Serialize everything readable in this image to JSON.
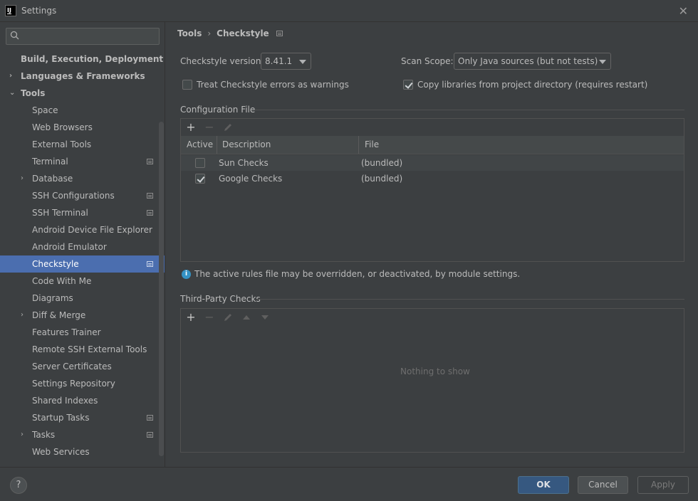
{
  "window": {
    "title": "Settings"
  },
  "sidebar": {
    "search_placeholder": "",
    "items": [
      {
        "label": "Build, Execution, Deployment",
        "level": 0,
        "bold": true,
        "arrow": ""
      },
      {
        "label": "Languages & Frameworks",
        "level": 0,
        "bold": true,
        "arrow": "›"
      },
      {
        "label": "Tools",
        "level": 0,
        "bold": true,
        "arrow": "⌄"
      },
      {
        "label": "Space",
        "level": 1
      },
      {
        "label": "Web Browsers",
        "level": 1
      },
      {
        "label": "External Tools",
        "level": 1
      },
      {
        "label": "Terminal",
        "level": 1,
        "project": true
      },
      {
        "label": "Database",
        "level": 1,
        "arrow": "›"
      },
      {
        "label": "SSH Configurations",
        "level": 1,
        "project": true
      },
      {
        "label": "SSH Terminal",
        "level": 1,
        "project": true
      },
      {
        "label": "Android Device File Explorer",
        "level": 1
      },
      {
        "label": "Android Emulator",
        "level": 1
      },
      {
        "label": "Checkstyle",
        "level": 1,
        "project": true,
        "selected": true
      },
      {
        "label": "Code With Me",
        "level": 1
      },
      {
        "label": "Diagrams",
        "level": 1
      },
      {
        "label": "Diff & Merge",
        "level": 1,
        "arrow": "›"
      },
      {
        "label": "Features Trainer",
        "level": 1
      },
      {
        "label": "Remote SSH External Tools",
        "level": 1
      },
      {
        "label": "Server Certificates",
        "level": 1
      },
      {
        "label": "Settings Repository",
        "level": 1
      },
      {
        "label": "Shared Indexes",
        "level": 1
      },
      {
        "label": "Startup Tasks",
        "level": 1,
        "project": true
      },
      {
        "label": "Tasks",
        "level": 1,
        "project": true,
        "arrow": "›"
      },
      {
        "label": "Web Services",
        "level": 1
      }
    ]
  },
  "breadcrumb": {
    "parent": "Tools",
    "separator": "›",
    "current": "Checkstyle"
  },
  "checkstyle": {
    "version_label": "Checkstyle version:",
    "version_value": "8.41.1",
    "scope_label": "Scan Scope:",
    "scope_value": "Only Java sources (but not tests)",
    "treat_errors_label": "Treat Checkstyle errors as warnings",
    "treat_errors_checked": false,
    "copy_libs_label": "Copy libraries from project directory (requires restart)",
    "copy_libs_checked": true
  },
  "config_file": {
    "title": "Configuration File",
    "columns": [
      "Active",
      "Description",
      "File"
    ],
    "rows": [
      {
        "active": false,
        "description": "Sun Checks",
        "file": "(bundled)"
      },
      {
        "active": true,
        "description": "Google Checks",
        "file": "(bundled)"
      }
    ],
    "info_text": "The active rules file may be overridden, or deactivated, by module settings."
  },
  "third_party": {
    "title": "Third-Party Checks",
    "empty_text": "Nothing to show"
  },
  "footer": {
    "help_label": "?",
    "ok_label": "OK",
    "cancel_label": "Cancel",
    "apply_label": "Apply"
  },
  "colors": {
    "background": "#3c3f41",
    "selection": "#4b6eaf",
    "ok_button": "#365880",
    "text": "#bbbbbb",
    "info": "#3592c4"
  }
}
